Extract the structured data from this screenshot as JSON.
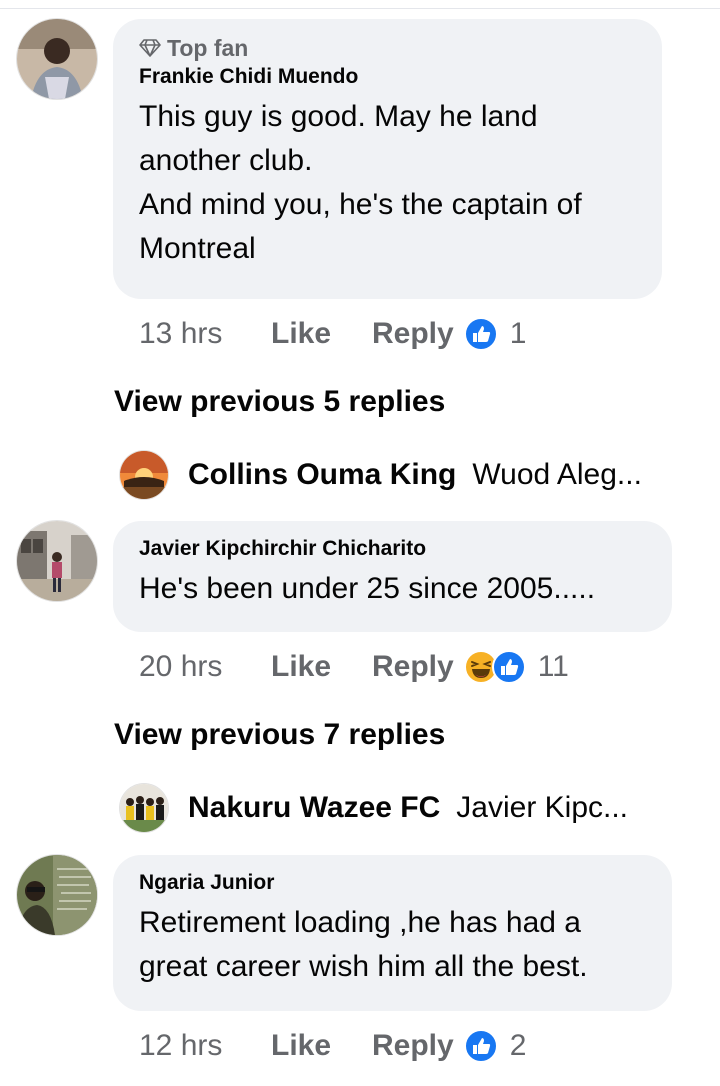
{
  "comments": [
    {
      "badge": "Top fan",
      "author": "Frankie Chidi Muendo",
      "text": "This guy is good. May he land another club.\nAnd mind you, he's the captain of Montreal",
      "time": "13 hrs",
      "like_label": "Like",
      "reply_label": "Reply",
      "reactions": [
        "like-icon"
      ],
      "reaction_count": "1"
    },
    {
      "author": "Javier Kipchirchir Chicharito",
      "text": "He's been under 25 since 2005.....",
      "time": "20 hrs",
      "like_label": "Like",
      "reply_label": "Reply",
      "reactions": [
        "haha-icon",
        "like-icon"
      ],
      "reaction_count": "11"
    },
    {
      "author": "Ngaria Junior",
      "text": "Retirement loading ,he has had a\ngreat career wish him all the best.",
      "time": "12 hrs",
      "like_label": "Like",
      "reply_label": "Reply",
      "reactions": [
        "like-icon"
      ],
      "reaction_count": "2"
    }
  ],
  "threads": [
    {
      "view_previous": "View previous 5 replies",
      "latest_reply": {
        "author": "Collins Ouma King",
        "snippet": "Wuod Aleg..."
      }
    },
    {
      "view_previous": "View previous 7 replies",
      "latest_reply": {
        "author": "Nakuru Wazee FC",
        "snippet": "Javier Kipc..."
      }
    }
  ],
  "colors": {
    "bubble": "#f0f2f5",
    "secondary_text": "#65676b",
    "like_blue": "#1877f2",
    "haha_yellow": "#f7b125"
  }
}
